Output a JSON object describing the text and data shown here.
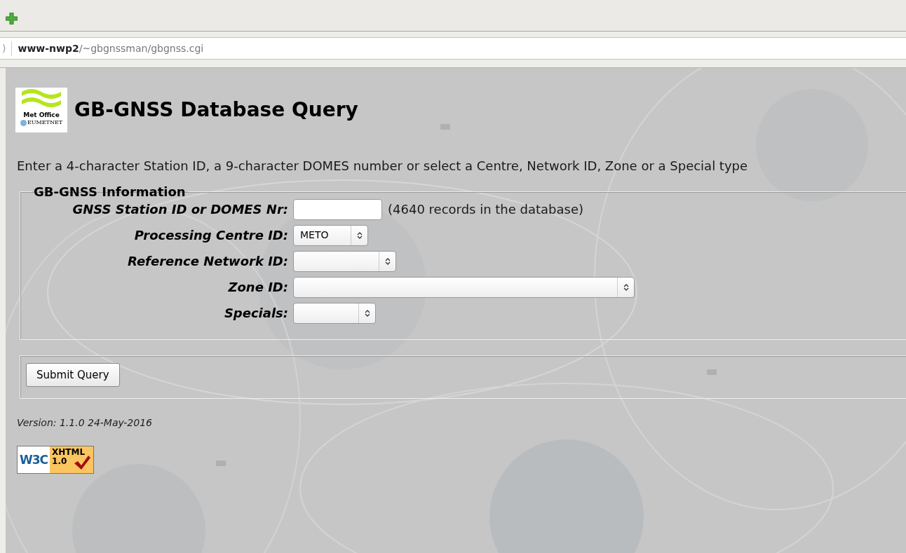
{
  "browser": {
    "url_fragment": ")",
    "url_host": "www-nwp2",
    "url_path": "/~gbgnssman/gbgnss.cgi"
  },
  "logo": {
    "name": "Met Office",
    "partner": "EUMETNET"
  },
  "title": "GB-GNSS Database Query",
  "intro": "Enter a 4-character Station ID, a 9-character DOMES number or select a Centre, Network ID, Zone or a Special type",
  "fieldset": {
    "legend": "GB-GNSS Information",
    "fields": [
      {
        "kind": "text",
        "label": "GNSS Station ID or DOMES Nr:",
        "note": "(4640 records in the database)"
      },
      {
        "kind": "select",
        "label": "Processing Centre ID:",
        "value": "METO"
      },
      {
        "kind": "select",
        "label": "Reference Network ID:"
      },
      {
        "kind": "select",
        "label": "Zone ID:"
      },
      {
        "kind": "select",
        "label": "Specials:"
      }
    ]
  },
  "submit": "Submit Query",
  "version": "Version: 1.1.0 24-May-2016",
  "badge": {
    "org": "W3C",
    "standard": "XHTML",
    "version": "1.0"
  }
}
